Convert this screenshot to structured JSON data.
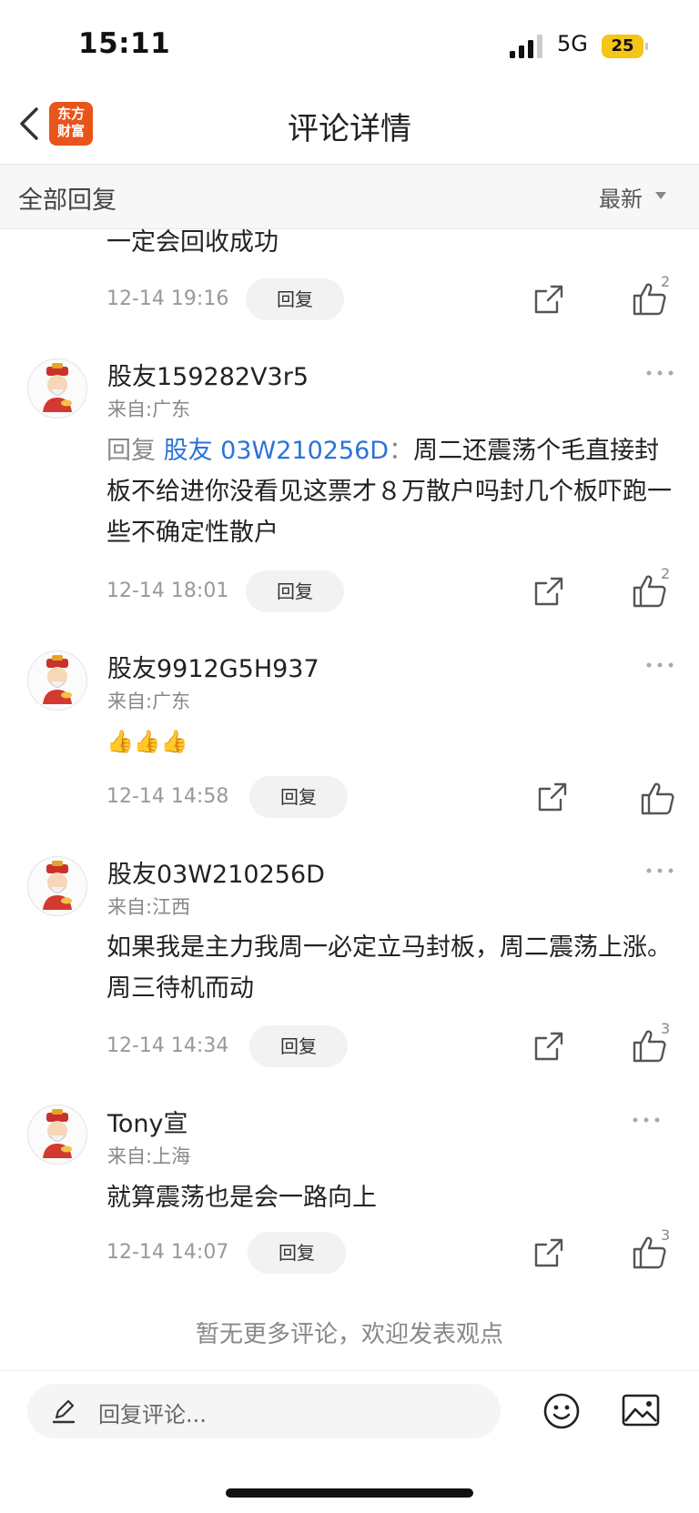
{
  "status_bar": {
    "time": "15:11",
    "network": "5G",
    "battery": "25"
  },
  "header": {
    "title": "评论详情",
    "logo_line1": "东方",
    "logo_line2": "财富"
  },
  "section": {
    "title": "全部回复",
    "sort_label": "最新"
  },
  "top_partial": {
    "text": "一定会回收成功",
    "time": "12-14 19:16",
    "reply_label": "回复",
    "likes": "2"
  },
  "comments": [
    {
      "username": "股友159282V3r5",
      "location": "来自:广东",
      "reply_prefix": "回复",
      "reply_target": "股友 03W210256D",
      "reply_sep": "：",
      "text": "周二还震荡个毛直接封板不给进你没看见这票才８万散户吗封几个板吓跑一些不确定性散户",
      "time": "12-14 18:01",
      "reply_label": "回复",
      "likes": "2"
    },
    {
      "username": "股友9912G5H937",
      "location": "来自:广东",
      "text": "👍👍👍",
      "time": "12-14 14:58",
      "reply_label": "回复",
      "likes": ""
    },
    {
      "username": "股友03W210256D",
      "location": "来自:江西",
      "text": "如果我是主力我周一必定立马封板，周二震荡上涨。周三待机而动",
      "time": "12-14 14:34",
      "reply_label": "回复",
      "likes": "3"
    },
    {
      "username": "Tony宣",
      "location": "来自:上海",
      "text": "就算震荡也是会一路向上",
      "time": "12-14 14:07",
      "reply_label": "回复",
      "likes": "3"
    }
  ],
  "footer": {
    "end_note": "暂无更多评论，欢迎发表观点",
    "input_placeholder": "回复评论..."
  },
  "colors": {
    "brand": "#e8541a",
    "link": "#2c72d8",
    "battery": "#f5c518"
  }
}
